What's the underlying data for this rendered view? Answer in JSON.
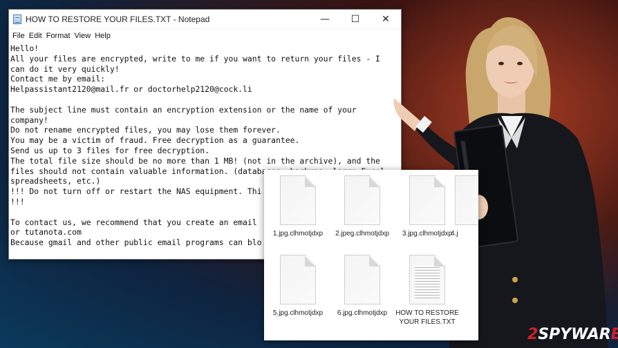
{
  "window": {
    "title": "HOW TO RESTORE YOUR FILES.TXT - Notepad",
    "minimize": "—",
    "maximize": "☐",
    "close": "✕"
  },
  "menu": [
    "File",
    "Edit",
    "Format",
    "View",
    "Help"
  ],
  "note_lines": [
    "Hello!",
    "All your files are encrypted, write to me if you want to return your files - I",
    "can do it very quickly!",
    "Contact me by email:",
    "Helpassistant2120@mail.fr or doctorhelp2120@cock.li",
    "",
    "The subject line must contain an encryption extension or the name of your",
    "company!",
    "Do not rename encrypted files, you may lose them forever.",
    "You may be a victim of fraud. Free decryption as a guarantee.",
    "Send us up to 3 files for free decryption.",
    "The total file size should be no more than 1 MB! (not in the archive), and the",
    "files should not contain valuable information. (databases, backups, large Excel",
    "spreadsheets, etc.)",
    "!!! Do not turn off or restart the NAS equipment. Thi",
    "!!!",
    "",
    "To contact us, we recommend that you create an email",
    "or tutanota.com",
    "Because gmail and other public email programs can blo"
  ],
  "files": [
    {
      "name": "1.jpg.clhmotjdxp",
      "icon": "blank-document-icon"
    },
    {
      "name": "2.jpeg.clhmotjdxp",
      "icon": "blank-document-icon"
    },
    {
      "name": "3.jpg.clhmotjdxp",
      "icon": "blank-document-icon"
    },
    {
      "name": "4.j",
      "icon": "blank-document-icon"
    },
    {
      "name": "5.jpg.clhmotjdxp",
      "icon": "blank-document-icon"
    },
    {
      "name": "6.jpg.clhmotjdxp",
      "icon": "blank-document-icon"
    },
    {
      "name": "HOW TO RESTORE YOUR FILES.TXT",
      "icon": "text-document-icon"
    }
  ],
  "watermark": {
    "brand_prefix": "2",
    "brand_main": "SPYWAR",
    "brand_suffix": "E"
  },
  "colors": {
    "watermark_red": "#d1202a",
    "suit": "#15171c",
    "hair": "#c9a66b"
  }
}
